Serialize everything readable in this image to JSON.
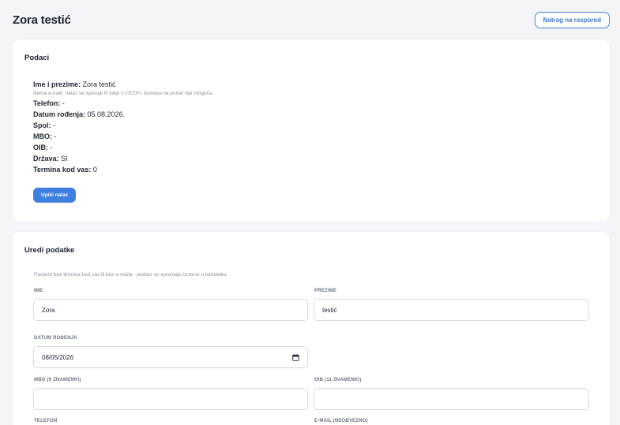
{
  "header": {
    "title": "Zora testić",
    "back_button": "Natrag na raspored"
  },
  "podaci": {
    "title": "Podaci",
    "name_label": "Ime i prezime:",
    "name_value": "Zora testić",
    "note": "Nema e-mail: nalaz se ispisuje ili šalje u CEZIH, dostava na portal nije moguća.",
    "rows": [
      {
        "label": "Telefon:",
        "value": "-"
      },
      {
        "label": "Datum rođenja:",
        "value": "05.08.2026."
      },
      {
        "label": "Spol:",
        "value": "-"
      },
      {
        "label": "MBO:",
        "value": "-"
      },
      {
        "label": "OIB:",
        "value": "-"
      },
      {
        "label": "Država:",
        "value": "SI"
      },
      {
        "label": "Termina kod vas:",
        "value": "0"
      }
    ],
    "upisi_button": "Upiši nalaz"
  },
  "edit": {
    "title": "Uredi podatke",
    "note": "Pacijent bez termina kod vas ili bez e-maila - podaci se spremaju izravno u kartoteku.",
    "ime_label": "IME",
    "ime_value": "Zora",
    "prezime_label": "PREZIME",
    "prezime_value": "testić",
    "datum_label": "DATUM ROĐENJA",
    "datum_value": "08/05/2026",
    "mbo_label": "MBO (9 ZNAMENKI)",
    "mbo_value": "",
    "oib_label": "OIB (11 ZNAMENKI)",
    "oib_value": "",
    "telefon_label": "TELEFON",
    "email_label": "E-MAIL (NEOBVEZNO)"
  }
}
